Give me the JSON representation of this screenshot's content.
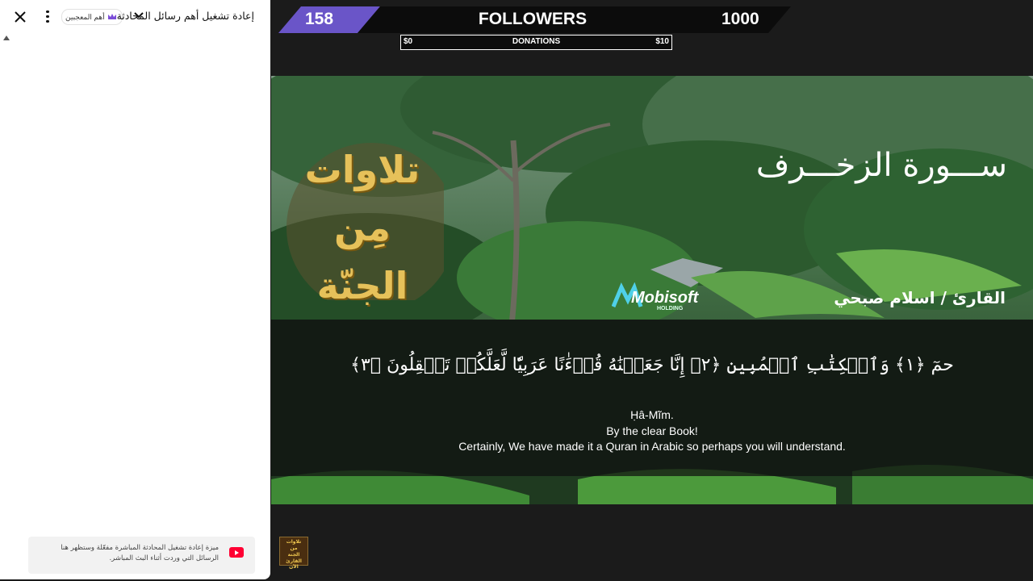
{
  "chat": {
    "title": "إعادة تشغيل أهم رسائل المحادثة",
    "top_fans_label": "أهم المعجبين",
    "replay_note": "ميزة إعادة تشغيل المحادثة المباشرة مفعّلة وستظهر هنا الرسائل التي وردت أثناء البث المباشر."
  },
  "overlay": {
    "followers_count": "158",
    "followers_label": "FOLLOWERS",
    "followers_goal": "1000",
    "followers_progress": 0.158,
    "donations_min": "$0",
    "donations_label": "DONATIONS",
    "donations_max": "$10",
    "accent_color": "#6a55c8"
  },
  "video": {
    "logo_lines": [
      "تلاوات",
      "مِن",
      "الجنّة"
    ],
    "surah_title": "ســـورة الزخـــرف",
    "reciter": "القارئ / اسلام صبحي",
    "watermark": "Mobisoft",
    "watermark_sub": "HOLDING",
    "ayah": "حمٓ ﴿١﴾ وَٱلۡكِتَٰبِ ٱلۡمُبِينِ ﴿٢﴾ إِنَّا جَعَلۡنَٰهُ قُرۡءَٰنًا عَرَبِيّٗا لَّعَلَّكُمۡ تَعۡقِلُونَ ﴿٣﴾",
    "translation": [
      "Ḥâ-Mĩm.",
      "By the clear Book!",
      "Certainly, We have made it a Quran in Arabic so perhaps you will understand."
    ]
  },
  "thumbnail": {
    "lines": [
      "تلاوات",
      "من",
      "الجنة",
      "القارئ الآن"
    ]
  }
}
